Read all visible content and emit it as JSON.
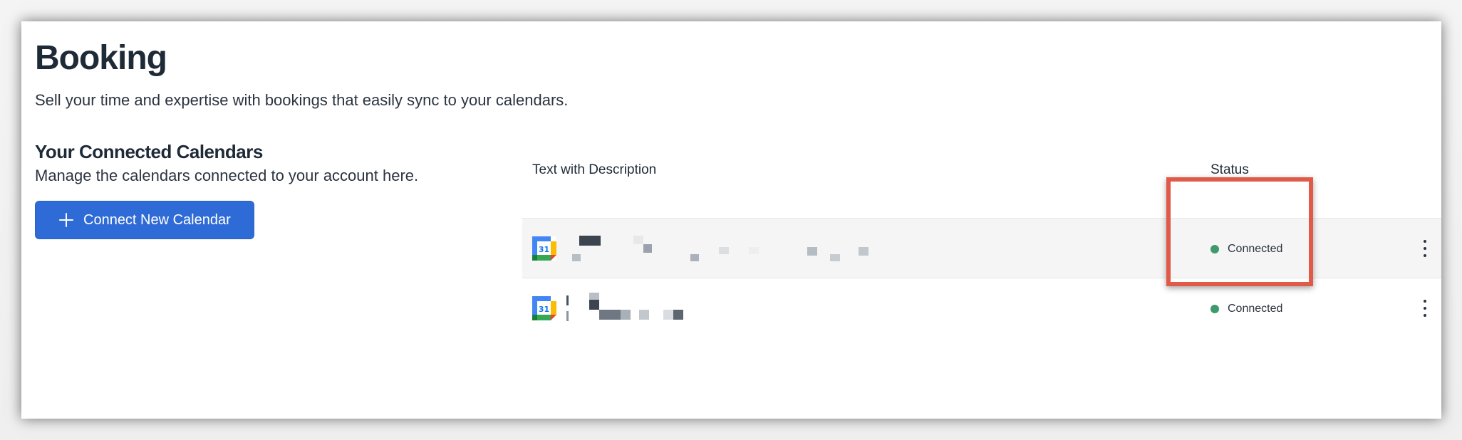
{
  "page": {
    "title": "Booking",
    "subtitle": "Sell your time and expertise with bookings that easily sync to your calendars."
  },
  "section": {
    "title": "Your Connected Calendars",
    "description": "Manage the calendars connected to your account here.",
    "connect_button_label": "Connect New Calendar",
    "connect_button_icon": "plus-icon"
  },
  "table": {
    "columns": [
      "Text with Description",
      "Status"
    ],
    "rows": [
      {
        "icon": "google-calendar-icon",
        "name": "",
        "description": "",
        "status": "Connected",
        "status_color": "#3d9a6a"
      },
      {
        "icon": "google-calendar-icon",
        "name": "",
        "description": "",
        "status": "Connected",
        "status_color": "#3d9a6a"
      }
    ]
  },
  "colors": {
    "primary_button": "#2f6bd6",
    "highlight_box": "#e05a47",
    "status_connected": "#3d9a6a"
  }
}
